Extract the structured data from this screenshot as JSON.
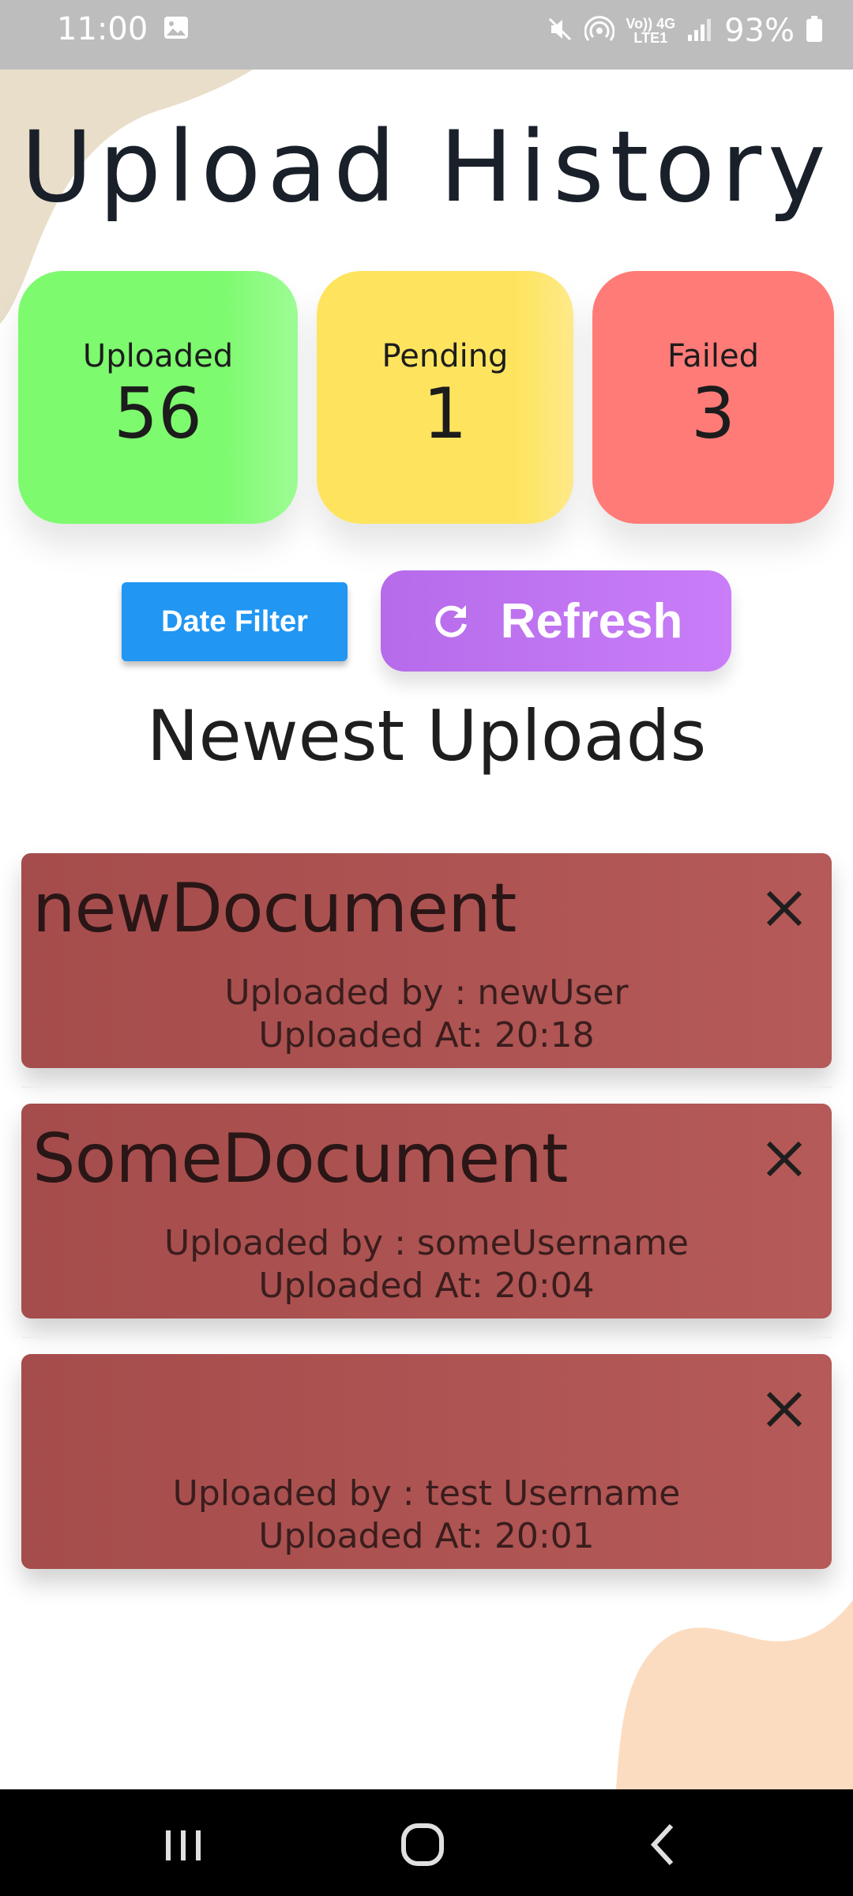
{
  "status_bar": {
    "time": "11:00",
    "battery": "93%",
    "network_top": "Vo)) 4G",
    "network_bottom": "LTE1",
    "icons": [
      "gallery-icon",
      "mute-icon",
      "hotspot-icon",
      "volte-icon",
      "4g-icon",
      "signal-icon",
      "battery-icon"
    ]
  },
  "page": {
    "title": "Upload History"
  },
  "stats": {
    "uploaded": {
      "label": "Uploaded",
      "value": "56",
      "color": "#7dfa6e"
    },
    "pending": {
      "label": "Pending",
      "value": "1",
      "color": "#fee45e"
    },
    "failed": {
      "label": "Failed",
      "value": "3",
      "color": "#ff7b78"
    }
  },
  "actions": {
    "date_filter_label": "Date Filter",
    "refresh_label": "Refresh",
    "date_filter_color": "#2196f3",
    "refresh_color": "#c17af5"
  },
  "section": {
    "title": "Newest Uploads"
  },
  "uploads": [
    {
      "name": "newDocument",
      "uploaded_by": "Uploaded by : newUser",
      "uploaded_at": "Uploaded At: 20:18"
    },
    {
      "name": "SomeDocument",
      "uploaded_by": "Uploaded by : someUsername",
      "uploaded_at": "Uploaded At: 20:04"
    },
    {
      "name": "",
      "uploaded_by": "Uploaded by : test Username",
      "uploaded_at": "Uploaded At: 20:01"
    }
  ],
  "colors": {
    "card_background": "#b05654",
    "background_blob_top": "#e8dcc8",
    "background_blob_bottom": "#fcdcc0"
  },
  "nav_bar": {
    "icons": [
      "recent-apps-icon",
      "home-icon",
      "back-icon"
    ]
  }
}
